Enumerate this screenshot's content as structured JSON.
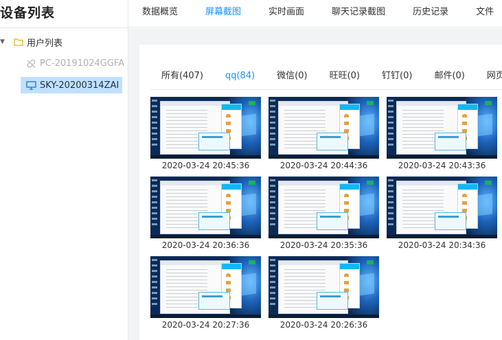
{
  "sidebar": {
    "title": "设备列表",
    "tree_root": {
      "label": "用户列表",
      "icon": "folder-icon",
      "expanded": true
    },
    "devices": [
      {
        "label": "PC-20191024GGFA",
        "status": "offline",
        "icon": "link-broken-icon"
      },
      {
        "label": "SKY-20200314ZAI",
        "status": "online",
        "icon": "monitor-icon",
        "selected": true
      }
    ]
  },
  "top_tabs": [
    {
      "label": "数据概览"
    },
    {
      "label": "屏幕截图",
      "active": true
    },
    {
      "label": "实时画面"
    },
    {
      "label": "聊天记录截图"
    },
    {
      "label": "历史记录"
    },
    {
      "label": "文件"
    }
  ],
  "sub_tabs": [
    {
      "label": "所有(407)"
    },
    {
      "label": "qq(84)",
      "active": true
    },
    {
      "label": "微信(0)"
    },
    {
      "label": "旺旺(0)"
    },
    {
      "label": "钉钉(0)"
    },
    {
      "label": "邮件(0)"
    },
    {
      "label": "网页"
    }
  ],
  "screenshots": [
    {
      "time": "2020-03-24 20:45:36"
    },
    {
      "time": "2020-03-24 20:44:36"
    },
    {
      "time": "2020-03-24 20:43:36"
    },
    {
      "time": "2020-03-24 20:36:36"
    },
    {
      "time": "2020-03-24 20:35:36"
    },
    {
      "time": "2020-03-24 20:34:36"
    },
    {
      "time": "2020-03-24 20:27:36"
    },
    {
      "time": "2020-03-24 20:26:36"
    }
  ],
  "colors": {
    "accent": "#1890ff",
    "selected_bg": "#bfe1ff",
    "offline_text": "#b0b0b0",
    "folder": "#e6b422"
  }
}
